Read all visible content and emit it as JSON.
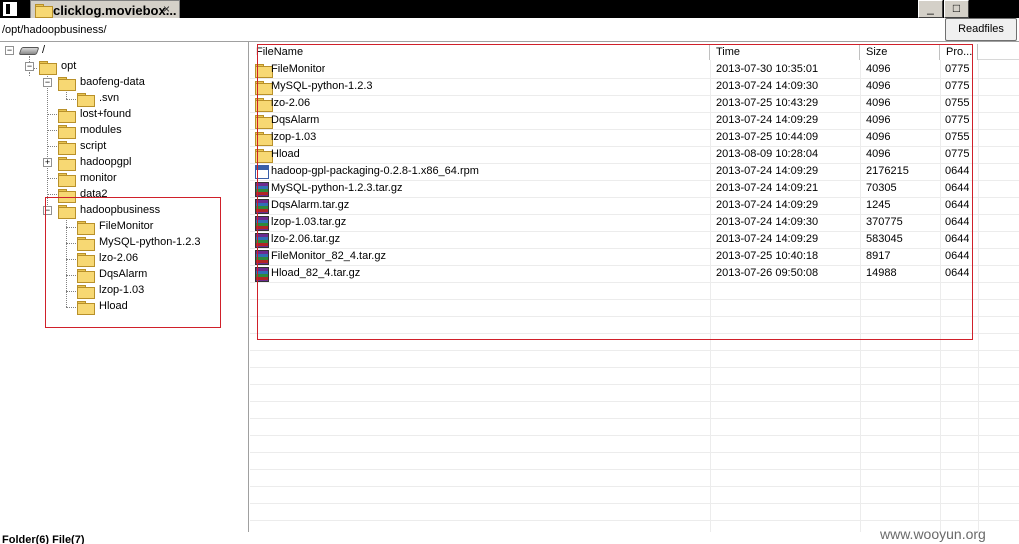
{
  "window": {
    "tab_title": "clicklog.moviebox...",
    "close_glyph": "×",
    "minimize_glyph": "_",
    "maximize_glyph": "□"
  },
  "pathbar": {
    "path": "/opt/hadoopbusiness/",
    "readfiles_label": "Readfiles"
  },
  "tree": {
    "root_label": "/",
    "nodes": [
      {
        "label": "opt"
      },
      {
        "label": "baofeng-data"
      },
      {
        "label": ".svn"
      },
      {
        "label": "lost+found"
      },
      {
        "label": "modules"
      },
      {
        "label": "script"
      },
      {
        "label": "hadoopgpl"
      },
      {
        "label": "monitor"
      },
      {
        "label": "data2"
      },
      {
        "label": "hadoopbusiness"
      },
      {
        "label": "FileMonitor"
      },
      {
        "label": "MySQL-python-1.2.3"
      },
      {
        "label": "lzo-2.06"
      },
      {
        "label": "DqsAlarm"
      },
      {
        "label": "lzop-1.03"
      },
      {
        "label": "Hload"
      }
    ]
  },
  "filelist": {
    "columns": [
      "FileName",
      "Time",
      "Size",
      "Pro..."
    ],
    "rows": [
      {
        "icon": "folder-icon",
        "name": "FileMonitor",
        "time": "2013-07-30 10:35:01",
        "size": "4096",
        "perm": "0775"
      },
      {
        "icon": "folder-icon",
        "name": "MySQL-python-1.2.3",
        "time": "2013-07-24 14:09:30",
        "size": "4096",
        "perm": "0775"
      },
      {
        "icon": "folder-icon",
        "name": "lzo-2.06",
        "time": "2013-07-25 10:43:29",
        "size": "4096",
        "perm": "0755"
      },
      {
        "icon": "folder-icon",
        "name": "DqsAlarm",
        "time": "2013-07-24 14:09:29",
        "size": "4096",
        "perm": "0775"
      },
      {
        "icon": "folder-icon",
        "name": "lzop-1.03",
        "time": "2013-07-25 10:44:09",
        "size": "4096",
        "perm": "0755"
      },
      {
        "icon": "folder-icon",
        "name": "Hload",
        "time": "2013-08-09 10:28:04",
        "size": "4096",
        "perm": "0775"
      },
      {
        "icon": "rpm-icon",
        "name": "hadoop-gpl-packaging-0.2.8-1.x86_64.rpm",
        "time": "2013-07-24 14:09:29",
        "size": "2176215",
        "perm": "0644"
      },
      {
        "icon": "archive-icon",
        "name": "MySQL-python-1.2.3.tar.gz",
        "time": "2013-07-24 14:09:21",
        "size": "70305",
        "perm": "0644"
      },
      {
        "icon": "archive-icon",
        "name": "DqsAlarm.tar.gz",
        "time": "2013-07-24 14:09:29",
        "size": "1245",
        "perm": "0644"
      },
      {
        "icon": "archive-icon",
        "name": "lzop-1.03.tar.gz",
        "time": "2013-07-24 14:09:30",
        "size": "370775",
        "perm": "0644"
      },
      {
        "icon": "archive-icon",
        "name": "lzo-2.06.tar.gz",
        "time": "2013-07-24 14:09:29",
        "size": "583045",
        "perm": "0644"
      },
      {
        "icon": "archive-icon",
        "name": "FileMonitor_82_4.tar.gz",
        "time": "2013-07-25 10:40:18",
        "size": "8917",
        "perm": "0644"
      },
      {
        "icon": "archive-icon",
        "name": "Hload_82_4.tar.gz",
        "time": "2013-07-26 09:50:08",
        "size": "14988",
        "perm": "0644"
      }
    ]
  },
  "status": {
    "text": "Folder(6) File(7)"
  },
  "watermark": "www.wooyun.org",
  "colors": {
    "highlight_box": "#d0202a"
  }
}
